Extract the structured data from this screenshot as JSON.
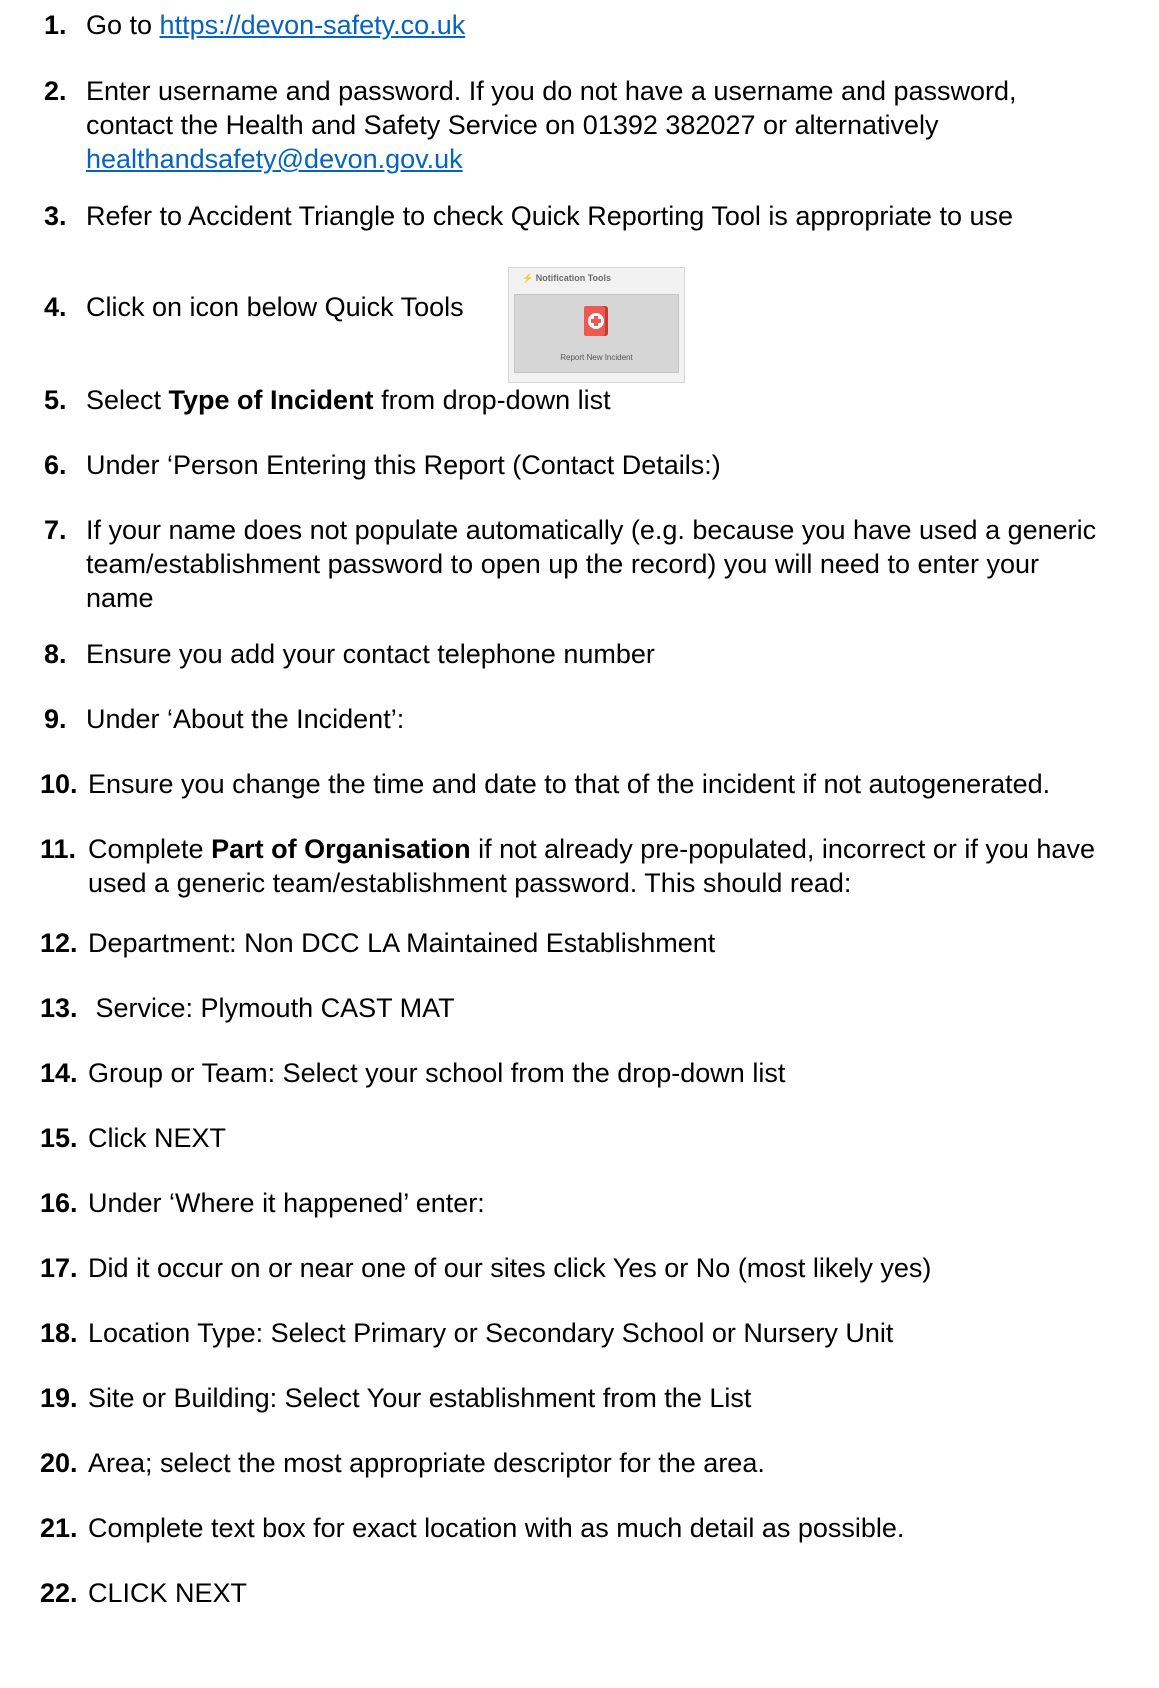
{
  "steps": [
    {
      "num": "1.",
      "before": "Go to ",
      "link": "https://devon-safety.co.uk"
    },
    {
      "num": "2.",
      "text": "Enter username and password. If you do not have a username and password,",
      "text2": "contact the Health and Safety Service on 01392 382027 or alternatively",
      "link": "healthandsafety@devon.gov.uk"
    },
    {
      "num": "3.",
      "text": "Refer to Accident Triangle to check Quick Reporting Tool is appropriate to use"
    },
    {
      "num": "4.",
      "text": "Click on icon below Quick Tools"
    },
    {
      "num": "5.",
      "before": "Select ",
      "bold": "Type of Incident",
      "after": " from drop-down list"
    },
    {
      "num": "6.",
      "text": "Under ‘Person Entering this Report (Contact Details:)"
    },
    {
      "num": "7.",
      "text": "If your name does not populate automatically (e.g. because you have used a generic",
      "text2": "team/establishment password to open up the record) you will need to enter your",
      "text3": "name"
    },
    {
      "num": "8.",
      "text": "Ensure you add your contact telephone number"
    },
    {
      "num": "9.",
      "text": "Under ‘About the Incident’:"
    },
    {
      "num": "10.",
      "text": "Ensure you change the time and date to that of the incident if not autogenerated."
    },
    {
      "num": "11.",
      "before": "Complete ",
      "bold": "Part of Organisation",
      "after": " if not already pre-populated, incorrect or if you have",
      "text2": "used a generic team/establishment password.  This should read:"
    },
    {
      "num": "12.",
      "text": "Department: Non DCC LA Maintained Establishment"
    },
    {
      "num": "13.",
      "text": " Service: Plymouth CAST MAT"
    },
    {
      "num": "14.",
      "text": "Group or Team: Select your school from the drop-down list"
    },
    {
      "num": "15.",
      "text": "Click NEXT"
    },
    {
      "num": "16.",
      "text": "Under ‘Where it happened’ enter:"
    },
    {
      "num": "17.",
      "text": "Did it occur on or near one of our sites click Yes or No (most likely yes)"
    },
    {
      "num": "18.",
      "text": "Location Type: Select Primary or Secondary School or Nursery Unit"
    },
    {
      "num": "19.",
      "text": "Site or Building: Select Your establishment from the List"
    },
    {
      "num": "20.",
      "text": "Area; select the most appropriate descriptor for the area."
    },
    {
      "num": "21.",
      "text": "Complete text box for exact location with as much detail as possible."
    },
    {
      "num": "22.",
      "text": "CLICK NEXT"
    }
  ],
  "tool_card": {
    "header": "⚡ Notification Tools",
    "button_label": "Report New Incident",
    "icon": "first-aid-book-icon"
  },
  "colors": {
    "link": "#0563c1",
    "icon_red": "#ee5a4f"
  }
}
